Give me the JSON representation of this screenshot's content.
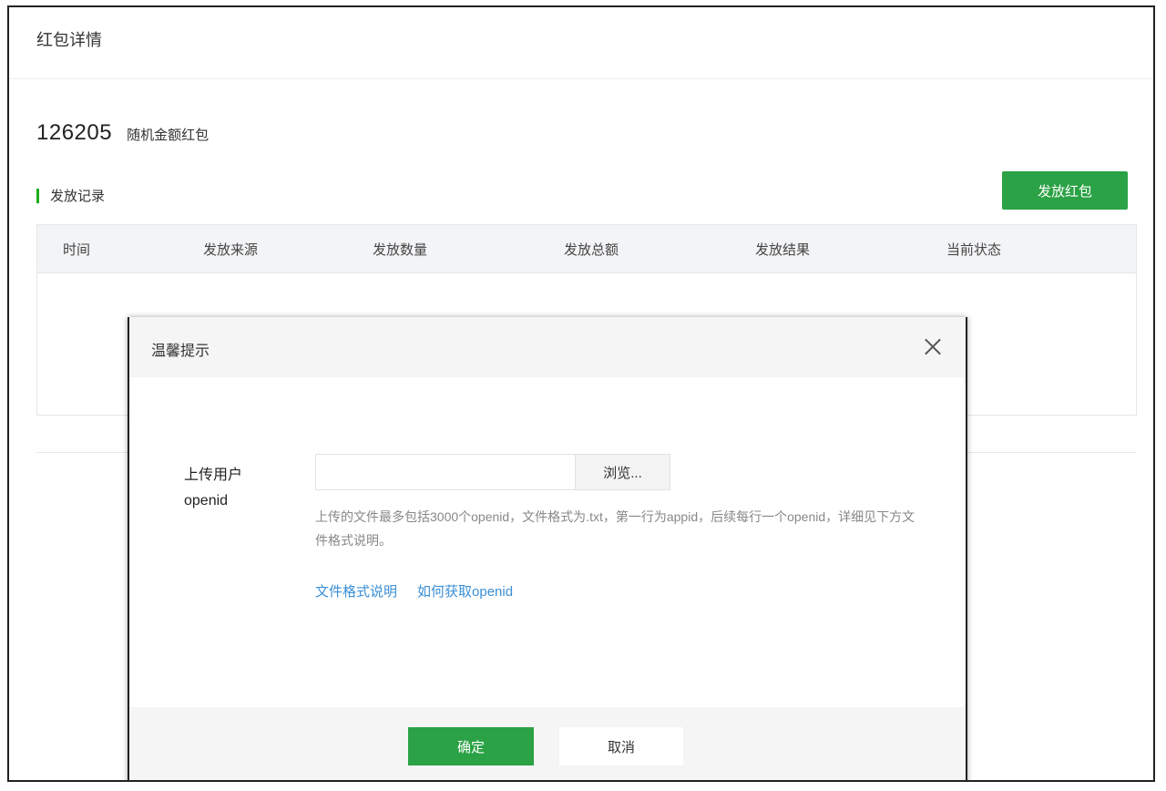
{
  "page": {
    "title": "红包详情"
  },
  "summary": {
    "id": "126205",
    "type": "随机金额红包"
  },
  "records": {
    "section_title": "发放记录",
    "issue_button_label": "发放红包",
    "columns": [
      "时间",
      "发放来源",
      "发放数量",
      "发放总额",
      "发放结果",
      "当前状态"
    ],
    "rows": []
  },
  "dialog": {
    "title": "温馨提示",
    "upload_label": "上传用户openid",
    "file_value": "",
    "browse_label": "浏览...",
    "help_text": "上传的文件最多包括3000个openid，文件格式为.txt，第一行为appid，后续每行一个openid，详细见下方文件格式说明。",
    "links": [
      "文件格式说明",
      "如何获取openid"
    ],
    "confirm_label": "确定",
    "cancel_label": "取消"
  },
  "colors": {
    "accent_green": "#2ba245",
    "link_blue": "#3a8fd6"
  }
}
